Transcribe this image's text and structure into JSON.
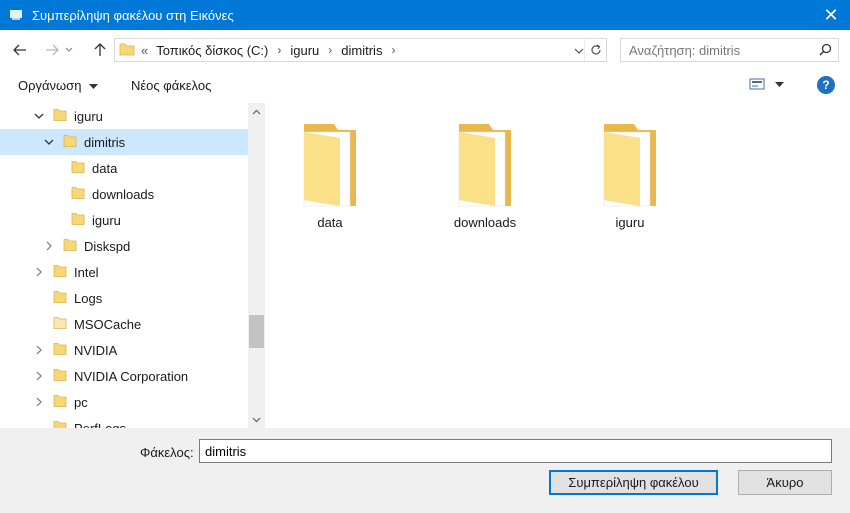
{
  "window": {
    "title": "Συμπερίληψη φακέλου στη Εικόνες",
    "close_glyph": "✕"
  },
  "nav": {
    "back_icon": "arrow-left-icon",
    "forward_icon": "arrow-right-icon",
    "up_icon": "arrow-up-icon",
    "address_prefix": "«",
    "breadcrumbs": [
      "Τοπικός δίσκος (C:)",
      "iguru",
      "dimitris"
    ],
    "search_placeholder": "Αναζήτηση: dimitris"
  },
  "toolbar": {
    "organize_label": "Οργάνωση",
    "new_folder_label": "Νέος φάκελος",
    "help_label": "?"
  },
  "tree": [
    {
      "label": "iguru",
      "chevron": "down",
      "selected": false
    },
    {
      "label": "dimitris",
      "chevron": "down",
      "selected": true
    },
    {
      "label": "data",
      "chevron": "",
      "selected": false
    },
    {
      "label": "downloads",
      "chevron": "",
      "selected": false
    },
    {
      "label": "iguru",
      "chevron": "",
      "selected": false
    },
    {
      "label": "Diskspd",
      "chevron": "right",
      "selected": false
    },
    {
      "label": "Intel",
      "chevron": "right",
      "selected": false
    },
    {
      "label": "Logs",
      "chevron": "",
      "selected": false
    },
    {
      "label": "MSOCache",
      "chevron": "",
      "selected": false
    },
    {
      "label": "NVIDIA",
      "chevron": "right",
      "selected": false
    },
    {
      "label": "NVIDIA Corporation",
      "chevron": "right",
      "selected": false
    },
    {
      "label": "pc",
      "chevron": "right",
      "selected": false
    },
    {
      "label": "PerfLogs",
      "chevron": "",
      "selected": false
    }
  ],
  "content": {
    "folders": [
      "data",
      "downloads",
      "iguru"
    ]
  },
  "bottom": {
    "folder_label": "Φάκελος:",
    "folder_value": "dimitris",
    "ok_label": "Συμπερίληψη φακέλου",
    "cancel_label": "Άκυρο"
  },
  "colors": {
    "accent": "#0078d7",
    "selection": "#cce8ff",
    "folder": "#f8d775"
  }
}
